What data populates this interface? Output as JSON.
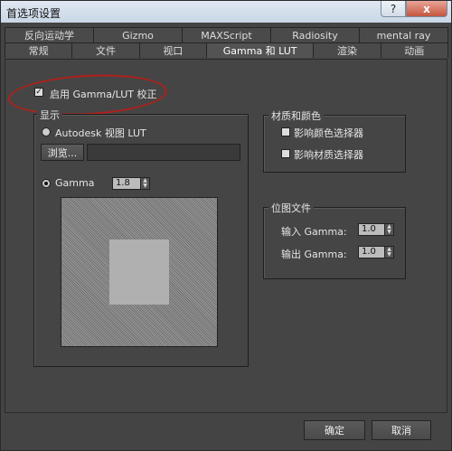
{
  "window": {
    "title": "首选项设置",
    "help_glyph": "?",
    "close_glyph": "x"
  },
  "tabs_row1": [
    "反向运动学",
    "Gizmo",
    "MAXScript",
    "Radiosity",
    "mental ray"
  ],
  "tabs_row2": [
    "常规",
    "文件",
    "视口",
    "Gamma 和 LUT",
    "渲染",
    "动画"
  ],
  "active_tab": "Gamma 和 LUT",
  "enable_gamma": {
    "label": "启用 Gamma/LUT 校正",
    "checked": true
  },
  "display_group": {
    "title": "显示",
    "lut_radio_label": "Autodesk 视图 LUT",
    "browse_label": "浏览...",
    "lut_path": "",
    "gamma_radio_label": "Gamma",
    "gamma_value": "1.8"
  },
  "material_group": {
    "title": "材质和颜色",
    "affect_color_selector": "影响颜色选择器",
    "affect_material_selector": "影响材质选择器"
  },
  "bitmap_group": {
    "title": "位图文件",
    "input_gamma_label": "输入 Gamma:",
    "input_gamma_value": "1.0",
    "output_gamma_label": "输出 Gamma:",
    "output_gamma_value": "1.0"
  },
  "footer": {
    "ok_label": "确定",
    "cancel_label": "取消"
  },
  "colors": {
    "annotation": "#b0201a",
    "panel": "#454545"
  }
}
